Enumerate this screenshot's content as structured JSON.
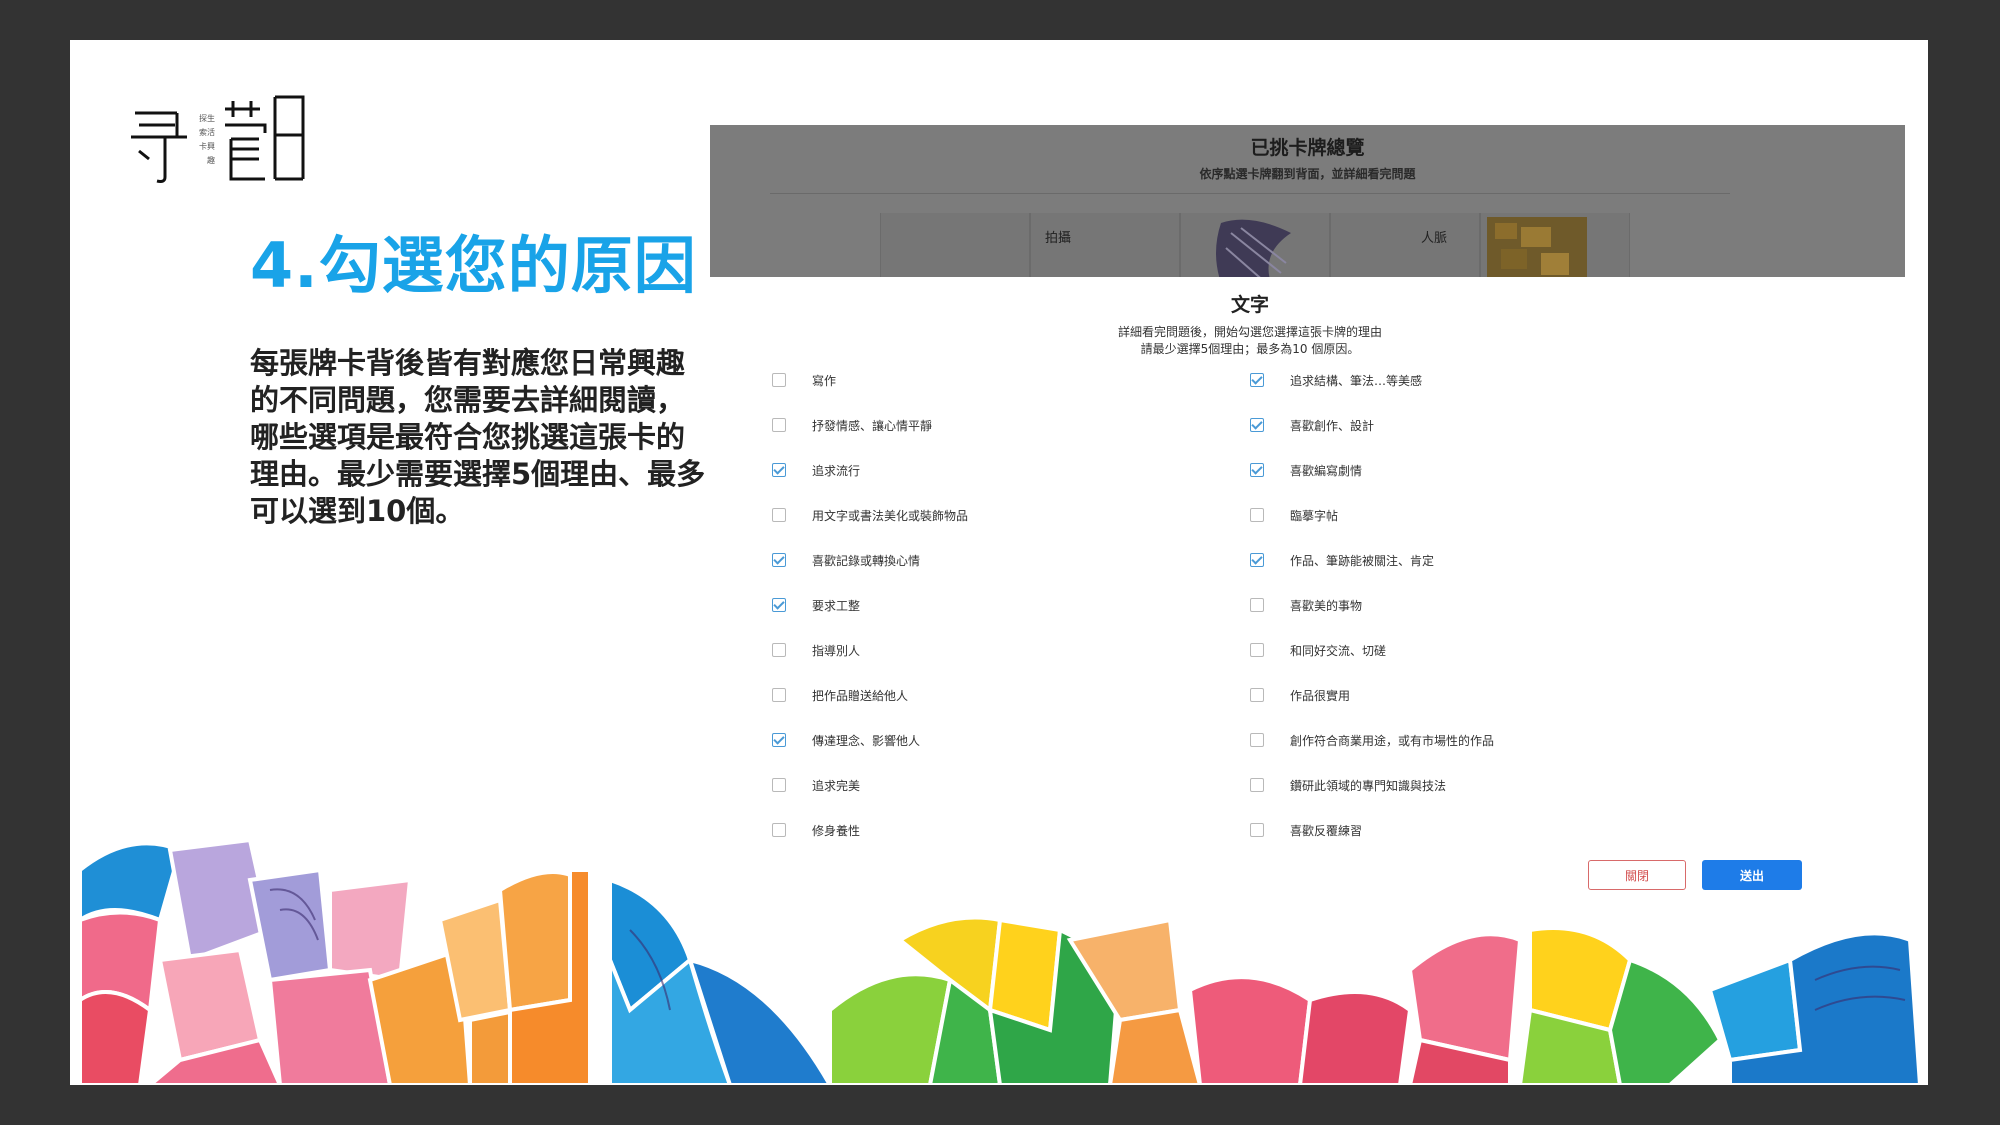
{
  "logo": {
    "side_text": "探生活索興卡趣"
  },
  "heading": "4.勾選您的原因",
  "description": "每張牌卡背後皆有對應您日常興趣的不同問題，您需要去詳細閱讀，哪些選項是最符合您挑選這張卡的理由。最少需要選擇5個理由、最多可以選到10個。",
  "overview": {
    "title": "已挑卡牌總覽",
    "subtitle": "依序點選卡牌翻到背面，並詳細看完問題",
    "cards": [
      "拍攝",
      "人脈"
    ]
  },
  "dialog": {
    "title": "文字",
    "instruction_1": "詳細看完問題後，開始勾選您選擇這張卡牌的理由",
    "instruction_2": "請最少選擇5個理由；最多為10 個原因。",
    "left_options": [
      {
        "label": "寫作",
        "checked": false
      },
      {
        "label": "抒發情感、讓心情平靜",
        "checked": false
      },
      {
        "label": "追求流行",
        "checked": true
      },
      {
        "label": "用文字或書法美化或裝飾物品",
        "checked": false
      },
      {
        "label": "喜歡記錄或轉換心情",
        "checked": true
      },
      {
        "label": "要求工整",
        "checked": true
      },
      {
        "label": "指導別人",
        "checked": false
      },
      {
        "label": "把作品贈送給他人",
        "checked": false
      },
      {
        "label": "傳達理念、影響他人",
        "checked": true
      },
      {
        "label": "追求完美",
        "checked": false
      },
      {
        "label": "修身養性",
        "checked": false
      }
    ],
    "right_options": [
      {
        "label": "追求結構、筆法…等美感",
        "checked": true
      },
      {
        "label": "喜歡創作、設計",
        "checked": true
      },
      {
        "label": "喜歡編寫劇情",
        "checked": true
      },
      {
        "label": "臨摹字帖",
        "checked": false
      },
      {
        "label": "作品、筆跡能被關注、肯定",
        "checked": true
      },
      {
        "label": "喜歡美的事物",
        "checked": false
      },
      {
        "label": "和同好交流、切磋",
        "checked": false
      },
      {
        "label": "作品很實用",
        "checked": false
      },
      {
        "label": "創作符合商業用途，或有市場性的作品",
        "checked": false
      },
      {
        "label": "鑽研此領域的專門知識與技法",
        "checked": false
      },
      {
        "label": "喜歡反覆練習",
        "checked": false
      }
    ],
    "close_label": "關閉",
    "submit_label": "送出"
  },
  "colors": {
    "heading": "#19a3e8",
    "checkbox_checked": "#4a9ad6",
    "submit_button": "#1e7ce8",
    "close_button": "#d35050",
    "background": "#333333"
  }
}
